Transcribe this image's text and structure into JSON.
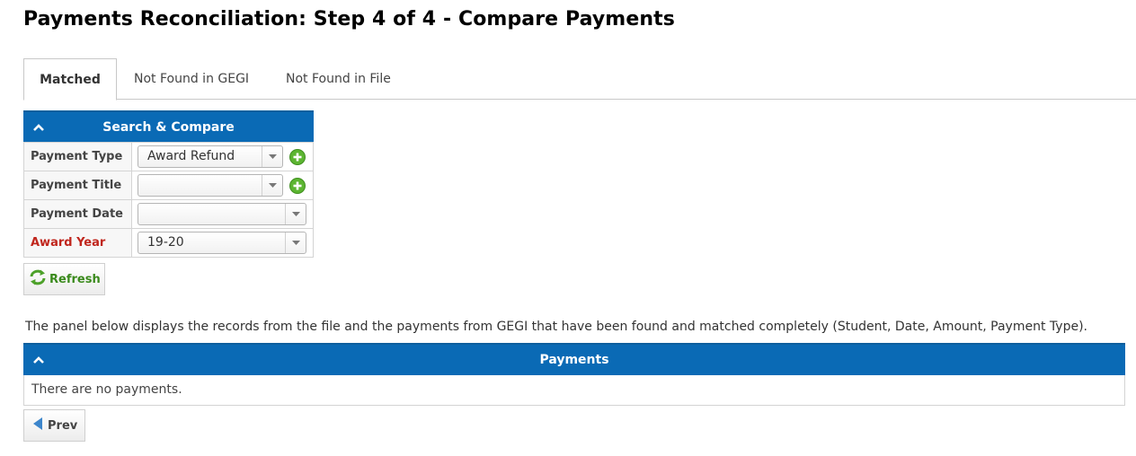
{
  "page": {
    "title": "Payments Reconciliation: Step 4 of 4 - Compare Payments"
  },
  "tabs": [
    {
      "label": "Matched",
      "active": true
    },
    {
      "label": "Not Found in GEGI",
      "active": false
    },
    {
      "label": "Not Found in File",
      "active": false
    }
  ],
  "search_panel": {
    "title": "Search & Compare",
    "fields": {
      "payment_type": {
        "label": "Payment Type",
        "value": "Award Refund"
      },
      "payment_title": {
        "label": "Payment Title",
        "value": ""
      },
      "payment_date": {
        "label": "Payment Date",
        "value": ""
      },
      "award_year": {
        "label": "Award Year",
        "value": "19-20",
        "required": true
      }
    },
    "refresh_label": "Refresh"
  },
  "description": "The panel below displays the records from the file and the payments from GEGI that have been found and matched completely (Student, Date, Amount, Payment Type).",
  "payments_panel": {
    "title": "Payments",
    "empty_message": "There are no payments."
  },
  "nav": {
    "prev_label": "Prev"
  },
  "colors": {
    "header_blue": "#0a6ab5",
    "required_red": "#c0261d",
    "refresh_green": "#3a8a1c",
    "add_icon_green": "#5cb531"
  },
  "icons": [
    "collapse-up-icon",
    "add-icon",
    "refresh-icon",
    "chevron-down-icon",
    "prev-arrow-icon"
  ]
}
